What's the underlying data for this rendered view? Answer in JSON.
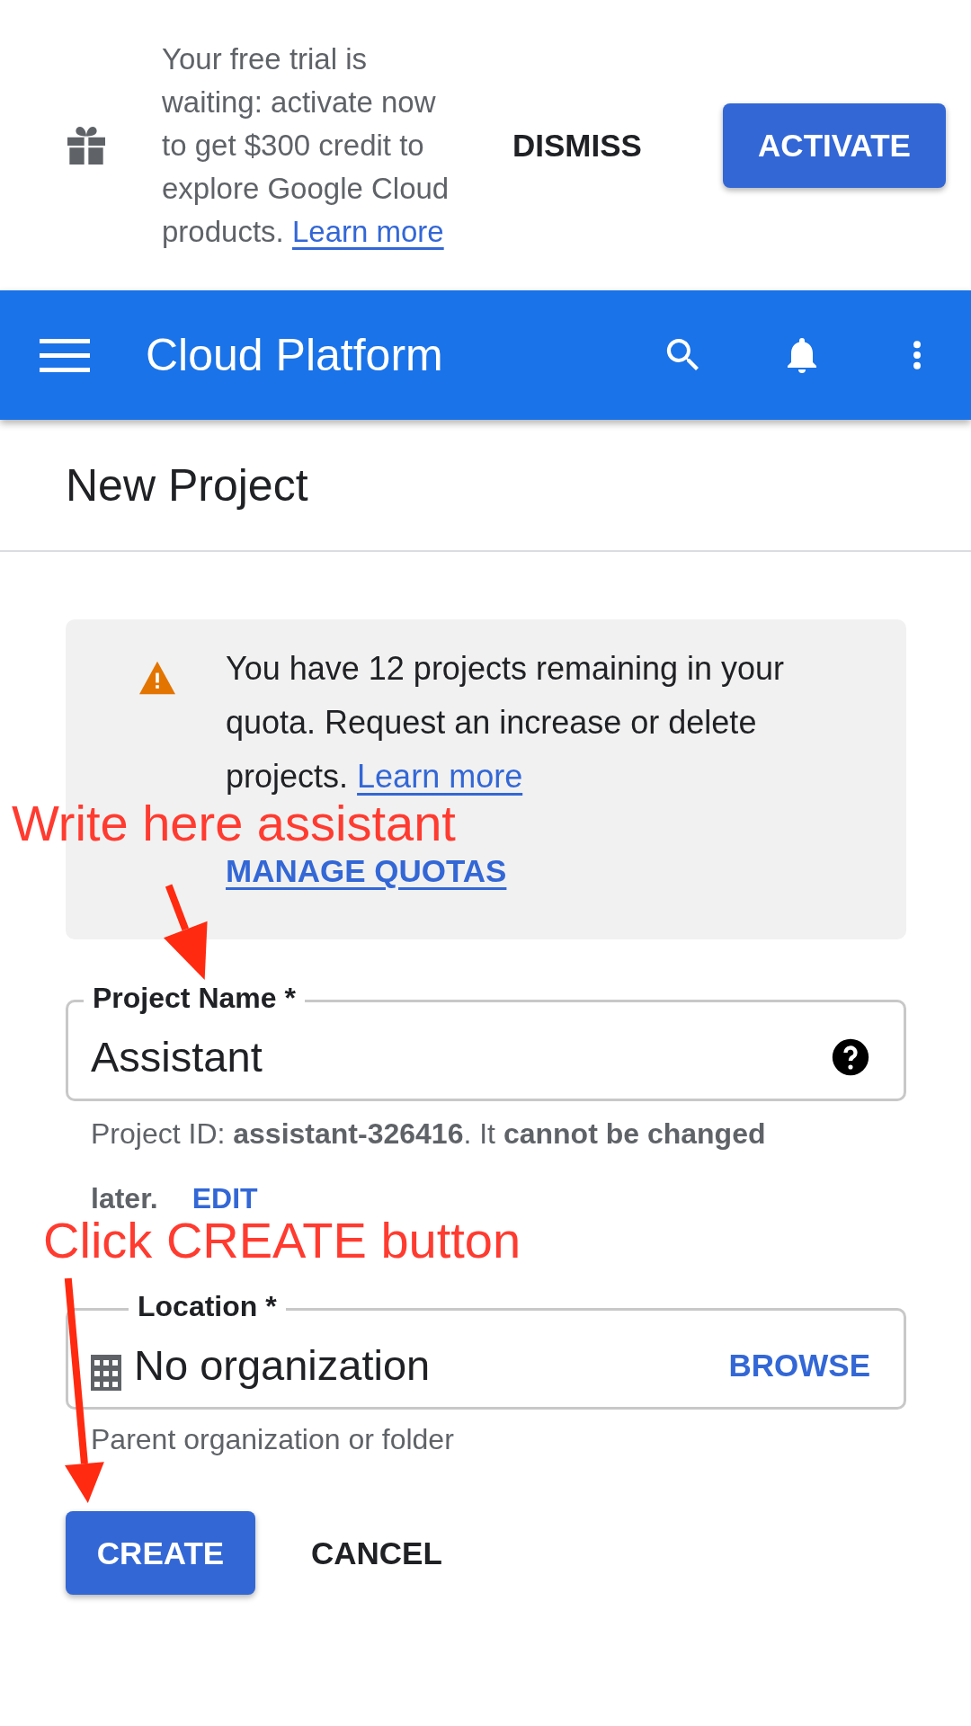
{
  "banner": {
    "message": "Your free trial is waiting: activate now to get $300 credit to explore Google Cloud products.",
    "link": "Learn more",
    "dismiss": "DISMISS",
    "activate": "ACTIVATE"
  },
  "app_bar": {
    "title": "Cloud Platform"
  },
  "page": {
    "title": "New Project"
  },
  "quota_notice": {
    "message": "You have 12 projects remaining in your quota. Request an increase or delete projects.",
    "link": "Learn more",
    "action": "MANAGE QUOTAS"
  },
  "project_name": {
    "label": "Project Name *",
    "value": "Assistant"
  },
  "project_id": {
    "text": "Project ID: **assistant-326416**. It **cannot be changed later.**",
    "edit": "EDIT"
  },
  "location": {
    "label": "Location *",
    "value": "No organization",
    "browse": "BROWSE",
    "helper": "Parent organization or folder"
  },
  "buttons": [
    {
      "label": "CREATE",
      "kind": "primary"
    },
    {
      "label": "CANCEL",
      "kind": "text"
    }
  ],
  "annotations": [
    {
      "text": "Write here assistant"
    },
    {
      "text": "Click CREATE button"
    }
  ]
}
